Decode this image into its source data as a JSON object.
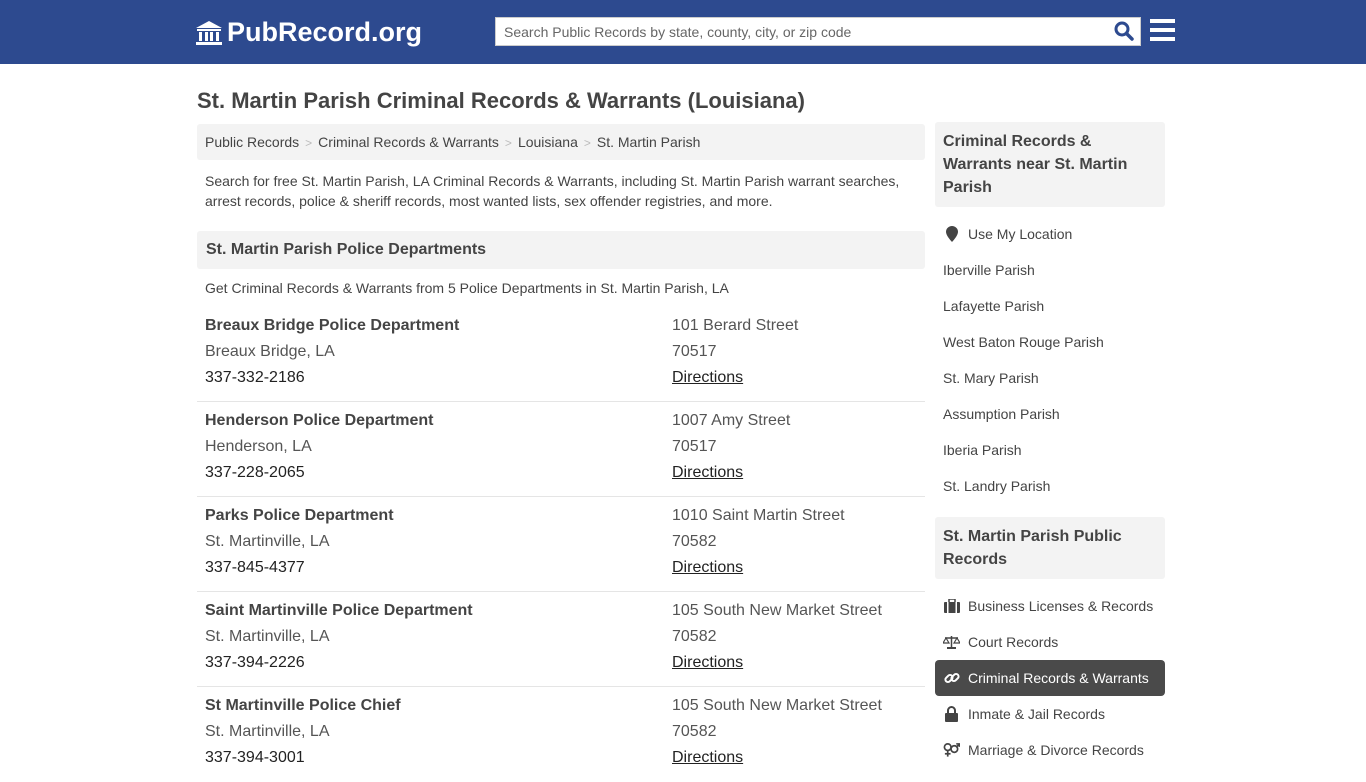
{
  "header": {
    "logo_text": "PubRecord.org",
    "search_placeholder": "Search Public Records by state, county, city, or zip code"
  },
  "page_title": "St. Martin Parish Criminal Records & Warrants (Louisiana)",
  "breadcrumb": [
    "Public Records",
    "Criminal Records & Warrants",
    "Louisiana",
    "St. Martin Parish"
  ],
  "intro": "Search for free St. Martin Parish, LA Criminal Records & Warrants, including St. Martin Parish warrant searches, arrest records, police & sheriff records, most wanted lists, sex offender registries, and more.",
  "section": {
    "title": "St. Martin Parish Police Departments",
    "subtitle": "Get Criminal Records & Warrants from 5 Police Departments in St. Martin Parish, LA",
    "departments": [
      {
        "name": "Breaux Bridge Police Department",
        "city": "Breaux Bridge, LA",
        "phone": "337-332-2186",
        "street": "101 Berard Street",
        "zip": "70517",
        "link": "Directions"
      },
      {
        "name": "Henderson Police Department",
        "city": "Henderson, LA",
        "phone": "337-228-2065",
        "street": "1007 Amy Street",
        "zip": "70517",
        "link": "Directions"
      },
      {
        "name": "Parks Police Department",
        "city": "St. Martinville, LA",
        "phone": "337-845-4377",
        "street": "1010 Saint Martin Street",
        "zip": "70582",
        "link": "Directions"
      },
      {
        "name": "Saint Martinville Police Department",
        "city": "St. Martinville, LA",
        "phone": "337-394-2226",
        "street": "105 South New Market Street",
        "zip": "70582",
        "link": "Directions"
      },
      {
        "name": "St Martinville Police Chief",
        "city": "St. Martinville, LA",
        "phone": "337-394-3001",
        "street": "105 South New Market Street",
        "zip": "70582",
        "link": "Directions"
      }
    ]
  },
  "sidebar": {
    "nearby_title": "Criminal Records & Warrants near St. Martin Parish",
    "use_location": "Use My Location",
    "nearby": [
      "Iberville Parish",
      "Lafayette Parish",
      "West Baton Rouge Parish",
      "St. Mary Parish",
      "Assumption Parish",
      "Iberia Parish",
      "St. Landry Parish"
    ],
    "records_title": "St. Martin Parish Public Records",
    "records": [
      {
        "label": "Business Licenses & Records",
        "icon": "briefcase-icon",
        "active": false
      },
      {
        "label": "Court Records",
        "icon": "scales-icon",
        "active": false
      },
      {
        "label": "Criminal Records & Warrants",
        "icon": "link-icon",
        "active": true
      },
      {
        "label": "Inmate & Jail Records",
        "icon": "lock-icon",
        "active": false
      },
      {
        "label": "Marriage & Divorce Records",
        "icon": "gender-icon",
        "active": false
      }
    ]
  }
}
